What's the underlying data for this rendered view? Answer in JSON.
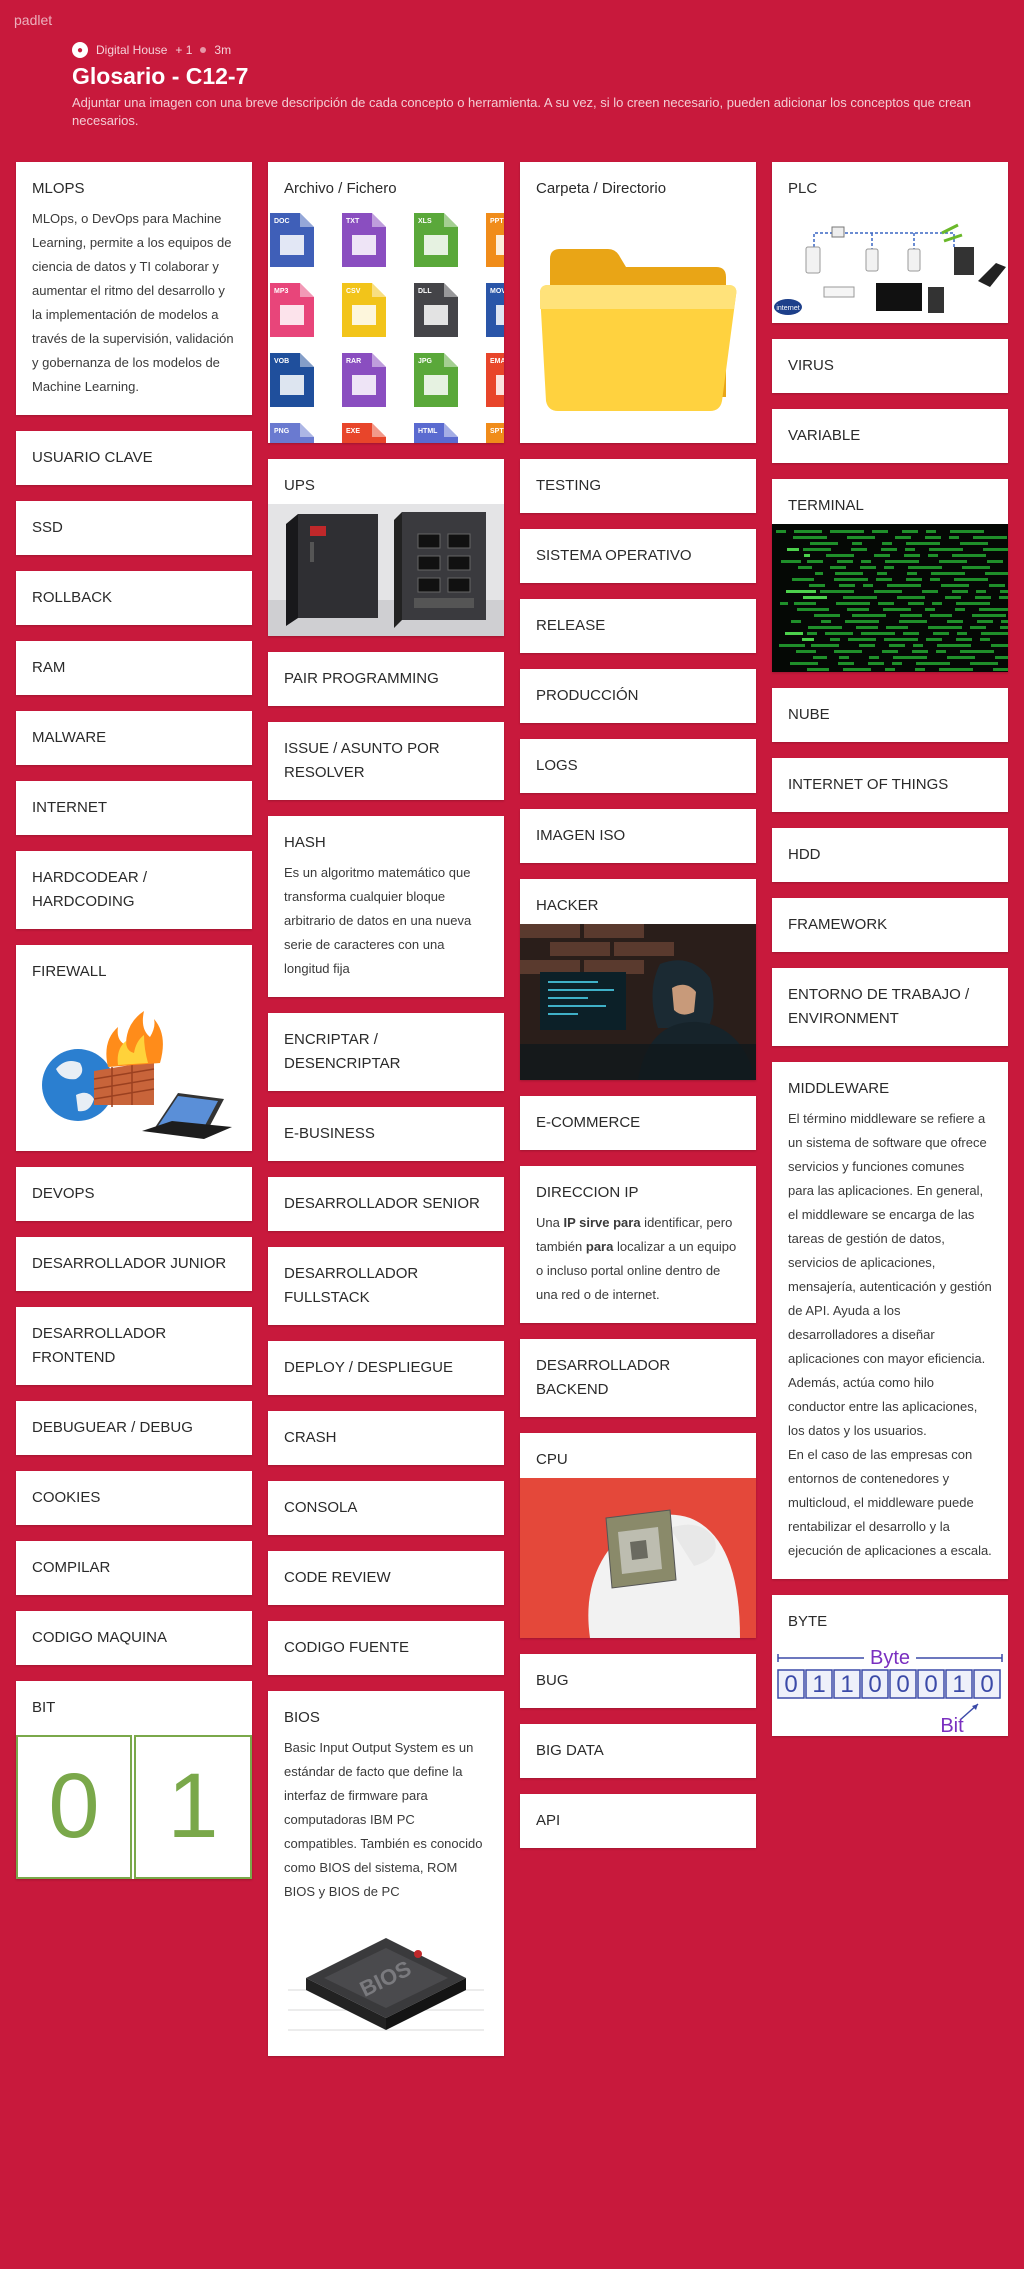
{
  "app": {
    "brand": "padlet"
  },
  "header": {
    "author": "Digital House",
    "plus": "+ 1",
    "time": "3m",
    "title": "Glosario - C12-7",
    "description": "Adjuntar una imagen con una breve descripción de cada concepto o herramienta. A su vez, si lo creen necesario, pueden adicionar los conceptos que crean necesarios."
  },
  "columns": {
    "c1": [
      {
        "title": "MLOPS",
        "body": "MLOps, o DevOps para Machine Learning, permite a los equipos de ciencia de datos y TI colaborar y aumentar el ritmo del desarrollo y la implementación de modelos a través de la supervisión, validación y gobernanza de los modelos de Machine Learning."
      },
      {
        "title": "USUARIO CLAVE"
      },
      {
        "title": "SSD"
      },
      {
        "title": "ROLLBACK"
      },
      {
        "title": "RAM"
      },
      {
        "title": "MALWARE"
      },
      {
        "title": "INTERNET"
      },
      {
        "title": "HARDCODEAR / HARDCODING"
      },
      {
        "title": "FIREWALL"
      },
      {
        "title": "DEVOPS"
      },
      {
        "title": "DESARROLLADOR JUNIOR"
      },
      {
        "title": "DESARROLLADOR FRONTEND"
      },
      {
        "title": "DEBUGUEAR / DEBUG"
      },
      {
        "title": "COOKIES"
      },
      {
        "title": "COMPILAR"
      },
      {
        "title": "CODIGO MAQUINA"
      },
      {
        "title": "BIT",
        "bits": [
          "0",
          "1"
        ]
      }
    ],
    "c2": [
      {
        "title": "Archivo / Fichero",
        "file_tags": [
          "DOC",
          "TXT",
          "XLS",
          "PPT",
          "MP3",
          "CSV",
          "DLL",
          "MOV",
          "VOB",
          "RAR",
          "JPG",
          "EMA",
          "PNG",
          "EXE",
          "HTML",
          "SPT"
        ]
      },
      {
        "title": "UPS"
      },
      {
        "title": "PAIR PROGRAMMING"
      },
      {
        "title": "ISSUE / ASUNTO POR RESOLVER"
      },
      {
        "title": "HASH",
        "body": "Es un algoritmo matemático que transforma cualquier bloque arbitrario de datos en una nueva serie de caracteres con una longitud fija"
      },
      {
        "title": "ENCRIPTAR / DESENCRIPTAR"
      },
      {
        "title": "E-BUSINESS"
      },
      {
        "title": "DESARROLLADOR SENIOR"
      },
      {
        "title": "DESARROLLADOR FULLSTACK"
      },
      {
        "title": "DEPLOY / DESPLIEGUE"
      },
      {
        "title": "CRASH"
      },
      {
        "title": "CONSOLA"
      },
      {
        "title": "CODE REVIEW"
      },
      {
        "title": "CODIGO FUENTE"
      },
      {
        "title": "BIOS",
        "body": "Basic Input Output System  es un estándar de facto que define la interfaz de firmware para computadoras IBM PC compatibles. También es conocido como BIOS del sistema, ROM BIOS y BIOS de PC",
        "chip_label": "BIOS"
      }
    ],
    "c3": [
      {
        "title": "Carpeta / Directorio"
      },
      {
        "title": "TESTING"
      },
      {
        "title": "SISTEMA OPERATIVO"
      },
      {
        "title": "RELEASE"
      },
      {
        "title": "PRODUCCIÓN"
      },
      {
        "title": "LOGS"
      },
      {
        "title": "IMAGEN ISO"
      },
      {
        "title": "HACKER"
      },
      {
        "title": "E-COMMERCE"
      },
      {
        "title": "DIRECCION IP",
        "body_parts": [
          "Una ",
          "IP sirve para",
          " identificar, pero también ",
          "para",
          " localizar a un equipo o incluso portal online dentro de una red o de internet."
        ]
      },
      {
        "title": "DESARROLLADOR BACKEND"
      },
      {
        "title": "CPU"
      },
      {
        "title": "BUG"
      },
      {
        "title": "BIG DATA"
      },
      {
        "title": "API"
      }
    ],
    "c4": [
      {
        "title": "PLC",
        "badge": "internet"
      },
      {
        "title": "VIRUS"
      },
      {
        "title": "VARIABLE"
      },
      {
        "title": "TERMINAL"
      },
      {
        "title": "NUBE"
      },
      {
        "title": "INTERNET OF THINGS"
      },
      {
        "title": "HDD"
      },
      {
        "title": "FRAMEWORK"
      },
      {
        "title": "ENTORNO DE TRABAJO / ENVIRONMENT"
      },
      {
        "title": "MIDDLEWARE",
        "body": "El término middleware se refiere a un sistema de software que ofrece servicios y funciones comunes para las aplicaciones. En general, el middleware se encarga de las tareas de gestión de datos, servicios de aplicaciones, mensajería, autenticación y gestión de API. Ayuda a los desarrolladores a diseñar aplicaciones con mayor eficiencia. Además, actúa como hilo conductor entre las aplicaciones, los datos y los usuarios.",
        "body2": "En el caso de las empresas con entornos de contenedores y multicloud, el middleware puede rentabilizar el desarrollo y la ejecución de aplicaciones a escala."
      },
      {
        "title": "BYTE",
        "byte_label": "Byte",
        "bit_label": "Bit",
        "digits": [
          "0",
          "1",
          "1",
          "0",
          "0",
          "0",
          "1",
          "0"
        ]
      }
    ]
  },
  "colors": {
    "background": "#c8193c",
    "card": "#ffffff",
    "bit_green": "#7aa84a",
    "byte_blue": "#3b4aa8",
    "byte_purple": "#7a2fc0"
  }
}
